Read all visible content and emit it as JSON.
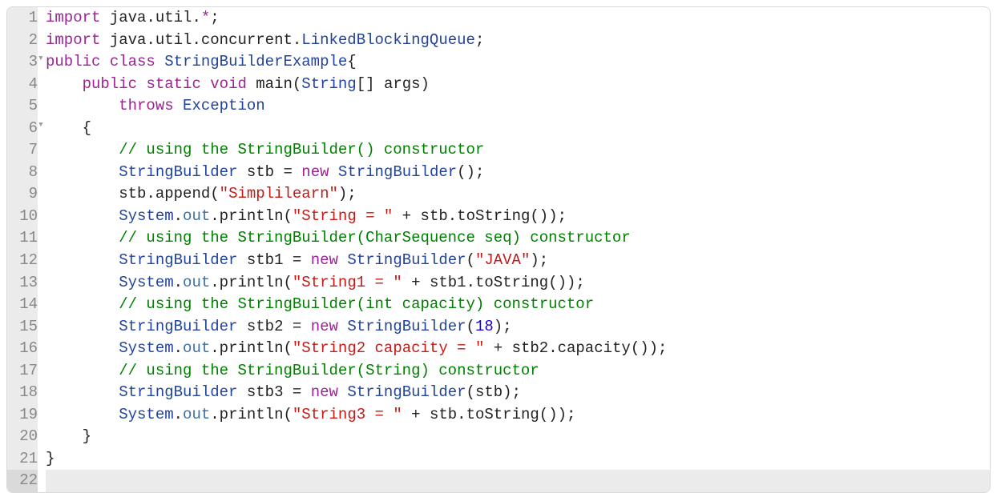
{
  "editor": {
    "language": "java",
    "active_line": 22,
    "lines": [
      {
        "n": 1,
        "fold": "",
        "tokens": [
          [
            "keyword",
            "import"
          ],
          [
            "punc",
            " "
          ],
          [
            "ident",
            "java"
          ],
          [
            "punc",
            "."
          ],
          [
            "ident",
            "util"
          ],
          [
            "punc",
            "."
          ],
          [
            "star",
            "*"
          ],
          [
            "punc",
            ";"
          ]
        ]
      },
      {
        "n": 2,
        "fold": "",
        "tokens": [
          [
            "keyword",
            "import"
          ],
          [
            "punc",
            " "
          ],
          [
            "ident",
            "java"
          ],
          [
            "punc",
            "."
          ],
          [
            "ident",
            "util"
          ],
          [
            "punc",
            "."
          ],
          [
            "ident",
            "concurrent"
          ],
          [
            "punc",
            "."
          ],
          [
            "type",
            "LinkedBlockingQueue"
          ],
          [
            "punc",
            ";"
          ]
        ]
      },
      {
        "n": 3,
        "fold": "▾",
        "tokens": [
          [
            "keyword",
            "public"
          ],
          [
            "punc",
            " "
          ],
          [
            "keyword",
            "class"
          ],
          [
            "punc",
            " "
          ],
          [
            "type",
            "StringBuilderExample"
          ],
          [
            "punc",
            "{"
          ]
        ]
      },
      {
        "n": 4,
        "fold": "",
        "tokens": [
          [
            "punc",
            "    "
          ],
          [
            "keyword",
            "public"
          ],
          [
            "punc",
            " "
          ],
          [
            "keyword",
            "static"
          ],
          [
            "punc",
            " "
          ],
          [
            "keyword",
            "void"
          ],
          [
            "punc",
            " "
          ],
          [
            "ident",
            "main"
          ],
          [
            "punc",
            "("
          ],
          [
            "type",
            "String"
          ],
          [
            "punc",
            "[] "
          ],
          [
            "ident",
            "args"
          ],
          [
            "punc",
            ")"
          ]
        ]
      },
      {
        "n": 5,
        "fold": "",
        "tokens": [
          [
            "punc",
            "        "
          ],
          [
            "keyword",
            "throws"
          ],
          [
            "punc",
            " "
          ],
          [
            "type",
            "Exception"
          ]
        ]
      },
      {
        "n": 6,
        "fold": "▾",
        "tokens": [
          [
            "punc",
            "    {"
          ]
        ]
      },
      {
        "n": 7,
        "fold": "",
        "tokens": [
          [
            "punc",
            "        "
          ],
          [
            "comment",
            "// using the StringBuilder() constructor"
          ]
        ]
      },
      {
        "n": 8,
        "fold": "",
        "tokens": [
          [
            "punc",
            "        "
          ],
          [
            "type",
            "StringBuilder"
          ],
          [
            "punc",
            " "
          ],
          [
            "ident",
            "stb"
          ],
          [
            "punc",
            " "
          ],
          [
            "op",
            "="
          ],
          [
            "punc",
            " "
          ],
          [
            "keyword",
            "new"
          ],
          [
            "punc",
            " "
          ],
          [
            "type",
            "StringBuilder"
          ],
          [
            "punc",
            "();"
          ]
        ]
      },
      {
        "n": 9,
        "fold": "",
        "tokens": [
          [
            "punc",
            "        "
          ],
          [
            "ident",
            "stb"
          ],
          [
            "punc",
            "."
          ],
          [
            "ident",
            "append"
          ],
          [
            "punc",
            "("
          ],
          [
            "string",
            "\"Simplilearn\""
          ],
          [
            "punc",
            ");"
          ]
        ]
      },
      {
        "n": 10,
        "fold": "",
        "tokens": [
          [
            "punc",
            "        "
          ],
          [
            "type",
            "System"
          ],
          [
            "punc",
            "."
          ],
          [
            "field",
            "out"
          ],
          [
            "punc",
            "."
          ],
          [
            "ident",
            "println"
          ],
          [
            "punc",
            "("
          ],
          [
            "string",
            "\"String = \""
          ],
          [
            "punc",
            " "
          ],
          [
            "op",
            "+"
          ],
          [
            "punc",
            " "
          ],
          [
            "ident",
            "stb"
          ],
          [
            "punc",
            "."
          ],
          [
            "ident",
            "toString"
          ],
          [
            "punc",
            "());"
          ]
        ]
      },
      {
        "n": 11,
        "fold": "",
        "tokens": [
          [
            "punc",
            "        "
          ],
          [
            "comment",
            "// using the StringBuilder(CharSequence seq) constructor"
          ]
        ]
      },
      {
        "n": 12,
        "fold": "",
        "tokens": [
          [
            "punc",
            "        "
          ],
          [
            "type",
            "StringBuilder"
          ],
          [
            "punc",
            " "
          ],
          [
            "ident",
            "stb1"
          ],
          [
            "punc",
            " "
          ],
          [
            "op",
            "="
          ],
          [
            "punc",
            " "
          ],
          [
            "keyword",
            "new"
          ],
          [
            "punc",
            " "
          ],
          [
            "type",
            "StringBuilder"
          ],
          [
            "punc",
            "("
          ],
          [
            "string",
            "\"JAVA\""
          ],
          [
            "punc",
            ");"
          ]
        ]
      },
      {
        "n": 13,
        "fold": "",
        "tokens": [
          [
            "punc",
            "        "
          ],
          [
            "type",
            "System"
          ],
          [
            "punc",
            "."
          ],
          [
            "field",
            "out"
          ],
          [
            "punc",
            "."
          ],
          [
            "ident",
            "println"
          ],
          [
            "punc",
            "("
          ],
          [
            "string",
            "\"String1 = \""
          ],
          [
            "punc",
            " "
          ],
          [
            "op",
            "+"
          ],
          [
            "punc",
            " "
          ],
          [
            "ident",
            "stb1"
          ],
          [
            "punc",
            "."
          ],
          [
            "ident",
            "toString"
          ],
          [
            "punc",
            "());"
          ]
        ]
      },
      {
        "n": 14,
        "fold": "",
        "tokens": [
          [
            "punc",
            "        "
          ],
          [
            "comment",
            "// using the StringBuilder(int capacity) constructor"
          ]
        ]
      },
      {
        "n": 15,
        "fold": "",
        "tokens": [
          [
            "punc",
            "        "
          ],
          [
            "type",
            "StringBuilder"
          ],
          [
            "punc",
            " "
          ],
          [
            "ident",
            "stb2"
          ],
          [
            "punc",
            " "
          ],
          [
            "op",
            "="
          ],
          [
            "punc",
            " "
          ],
          [
            "keyword",
            "new"
          ],
          [
            "punc",
            " "
          ],
          [
            "type",
            "StringBuilder"
          ],
          [
            "punc",
            "("
          ],
          [
            "number",
            "18"
          ],
          [
            "punc",
            ");"
          ]
        ]
      },
      {
        "n": 16,
        "fold": "",
        "tokens": [
          [
            "punc",
            "        "
          ],
          [
            "type",
            "System"
          ],
          [
            "punc",
            "."
          ],
          [
            "field",
            "out"
          ],
          [
            "punc",
            "."
          ],
          [
            "ident",
            "println"
          ],
          [
            "punc",
            "("
          ],
          [
            "string",
            "\"String2 capacity = \""
          ],
          [
            "punc",
            " "
          ],
          [
            "op",
            "+"
          ],
          [
            "punc",
            " "
          ],
          [
            "ident",
            "stb2"
          ],
          [
            "punc",
            "."
          ],
          [
            "ident",
            "capacity"
          ],
          [
            "punc",
            "());"
          ]
        ]
      },
      {
        "n": 17,
        "fold": "",
        "tokens": [
          [
            "punc",
            "        "
          ],
          [
            "comment",
            "// using the StringBuilder(String) constructor"
          ]
        ]
      },
      {
        "n": 18,
        "fold": "",
        "tokens": [
          [
            "punc",
            "        "
          ],
          [
            "type",
            "StringBuilder"
          ],
          [
            "punc",
            " "
          ],
          [
            "ident",
            "stb3"
          ],
          [
            "punc",
            " "
          ],
          [
            "op",
            "="
          ],
          [
            "punc",
            " "
          ],
          [
            "keyword",
            "new"
          ],
          [
            "punc",
            " "
          ],
          [
            "type",
            "StringBuilder"
          ],
          [
            "punc",
            "("
          ],
          [
            "ident",
            "stb"
          ],
          [
            "punc",
            ");"
          ]
        ]
      },
      {
        "n": 19,
        "fold": "",
        "tokens": [
          [
            "punc",
            "        "
          ],
          [
            "type",
            "System"
          ],
          [
            "punc",
            "."
          ],
          [
            "field",
            "out"
          ],
          [
            "punc",
            "."
          ],
          [
            "ident",
            "println"
          ],
          [
            "punc",
            "("
          ],
          [
            "string",
            "\"String3 = \""
          ],
          [
            "punc",
            " "
          ],
          [
            "op",
            "+"
          ],
          [
            "punc",
            " "
          ],
          [
            "ident",
            "stb"
          ],
          [
            "punc",
            "."
          ],
          [
            "ident",
            "toString"
          ],
          [
            "punc",
            "());"
          ]
        ]
      },
      {
        "n": 20,
        "fold": "",
        "tokens": [
          [
            "punc",
            "    }"
          ]
        ]
      },
      {
        "n": 21,
        "fold": "",
        "tokens": [
          [
            "punc",
            "}"
          ]
        ]
      },
      {
        "n": 22,
        "fold": "",
        "tokens": []
      }
    ]
  }
}
